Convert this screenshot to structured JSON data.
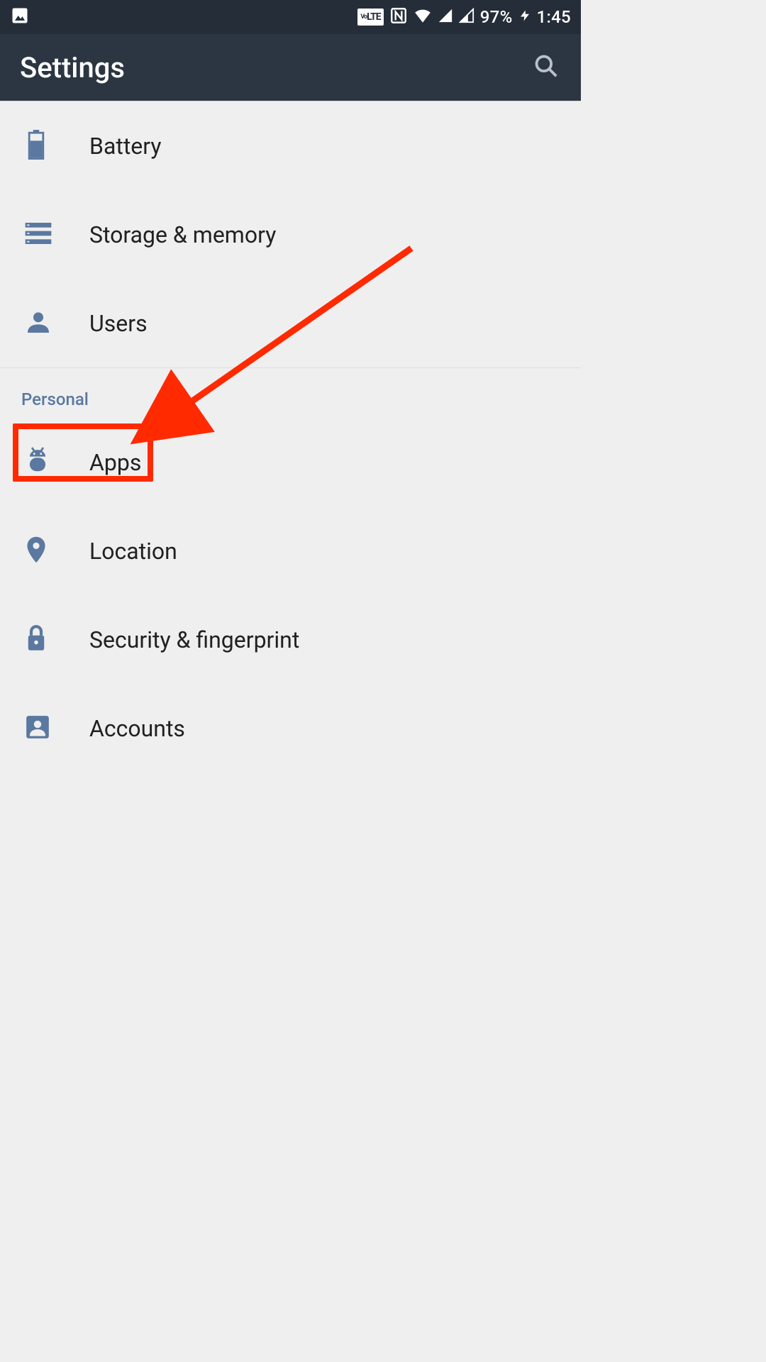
{
  "statusbar": {
    "volte": "V LTE",
    "battery_pct": "97%",
    "time": "1:45"
  },
  "appbar": {
    "title": "Settings"
  },
  "sections": {
    "top_items": [
      {
        "icon": "battery",
        "label": "Battery"
      },
      {
        "icon": "storage",
        "label": "Storage & memory"
      },
      {
        "icon": "user",
        "label": "Users"
      }
    ],
    "personal": {
      "header": "Personal",
      "items": [
        {
          "icon": "android",
          "label": "Apps"
        },
        {
          "icon": "location",
          "label": "Location"
        },
        {
          "icon": "lock",
          "label": "Security & fingerprint"
        },
        {
          "icon": "account",
          "label": "Accounts"
        }
      ]
    }
  },
  "annotation": {
    "highlight_target": "Apps"
  }
}
